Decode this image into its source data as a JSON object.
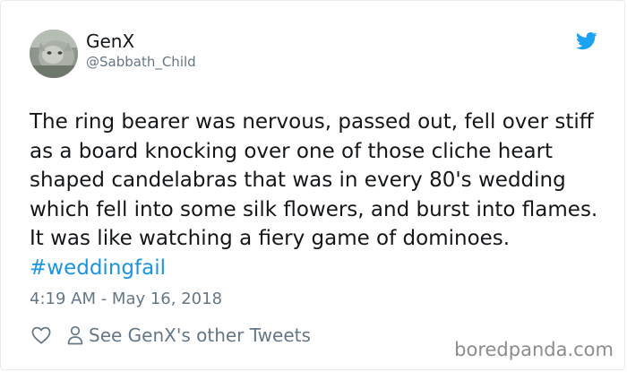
{
  "user": {
    "display_name": "GenX",
    "handle": "@Sabbath_Child"
  },
  "tweet": {
    "text": "The ring bearer was nervous, passed out, fell over stiff as a board knocking over one of those cliche heart shaped candelabras that was in every 80's wedding which fell into some silk flowers, and burst into flames. It was like watching a fiery game of dominoes. ",
    "hashtag": "#weddingfail",
    "timestamp": "4:19 AM - May 16, 2018"
  },
  "actions": {
    "like_icon": "heart-outline-icon",
    "profile_icon": "person-outline-icon",
    "see_tweets_label": "See GenX's other Tweets"
  },
  "brand": {
    "logo_icon": "twitter-bird-icon",
    "watermark": "boredpanda.com"
  },
  "colors": {
    "text": "#14171a",
    "secondary": "#657786",
    "link": "#1b95e0",
    "twitter_blue": "#1da1f2",
    "watermark": "#8c8c8c"
  }
}
